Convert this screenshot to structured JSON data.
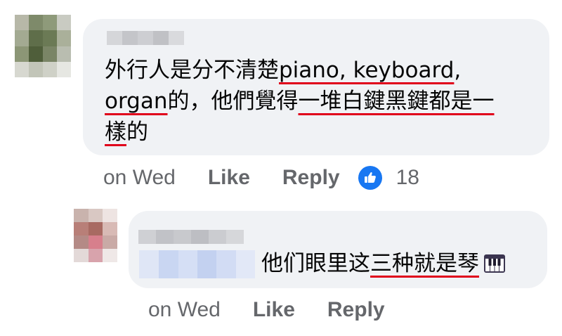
{
  "comments": [
    {
      "text_segments": [
        {
          "text": "外行人是分不清楚",
          "underline": false
        },
        {
          "text": "piano, keyboard",
          "underline": true
        },
        {
          "text": ", ",
          "underline": false
        },
        {
          "text": "organ",
          "underline": true
        },
        {
          "text": "的，他們覺得",
          "underline": false
        },
        {
          "text": "一堆白鍵黑鍵都是一",
          "underline": true
        },
        {
          "text": "樣",
          "underline": true
        },
        {
          "text": "的",
          "underline": false
        }
      ],
      "time": "on Wed",
      "like_label": "Like",
      "reply_label": "Reply",
      "reaction_count": "18"
    },
    {
      "text_segments": [
        {
          "text": "他们眼里这",
          "underline": false
        },
        {
          "text": "三种就是琴",
          "underline": true
        }
      ],
      "emoji": "musical-keyboard-icon",
      "time": "on Wed",
      "like_label": "Like",
      "reply_label": "Reply"
    }
  ],
  "colors": {
    "bubble": "#f0f2f5",
    "underline": "#e0001b",
    "meta": "#65676b",
    "like_blue": "#1877f2"
  }
}
